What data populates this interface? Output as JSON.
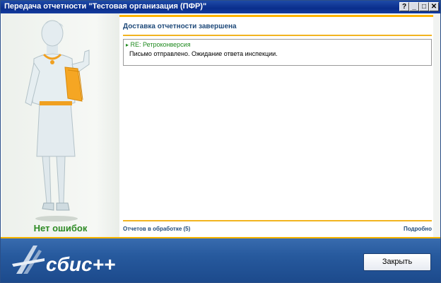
{
  "window": {
    "title": "Передача отчетности \"Тестовая организация (ПФР)\"",
    "controls": {
      "help": "?",
      "minimize": "_",
      "maximize": "□",
      "close": "✕"
    }
  },
  "left_panel": {
    "status_label": "Нет ошибок",
    "status_color": "#2d8a24",
    "illustration": "woman-holding-folder"
  },
  "main": {
    "heading": "Доставка отчетности завершена",
    "messages": [
      {
        "subject": "RE: Ретроконверсия",
        "text": "Письмо отправлено. Ожидание ответа инспекции."
      }
    ],
    "footer_left": "Отчетов в обработке (5)",
    "footer_right": "Подробно"
  },
  "bottom_bar": {
    "logo_text": "сбис++",
    "close_button": "Закрыть"
  },
  "colors": {
    "accent": "#ffb400",
    "heading": "#1f4a7a",
    "titlebar": "#0a2e8c",
    "bottombar": "#275a9e"
  }
}
